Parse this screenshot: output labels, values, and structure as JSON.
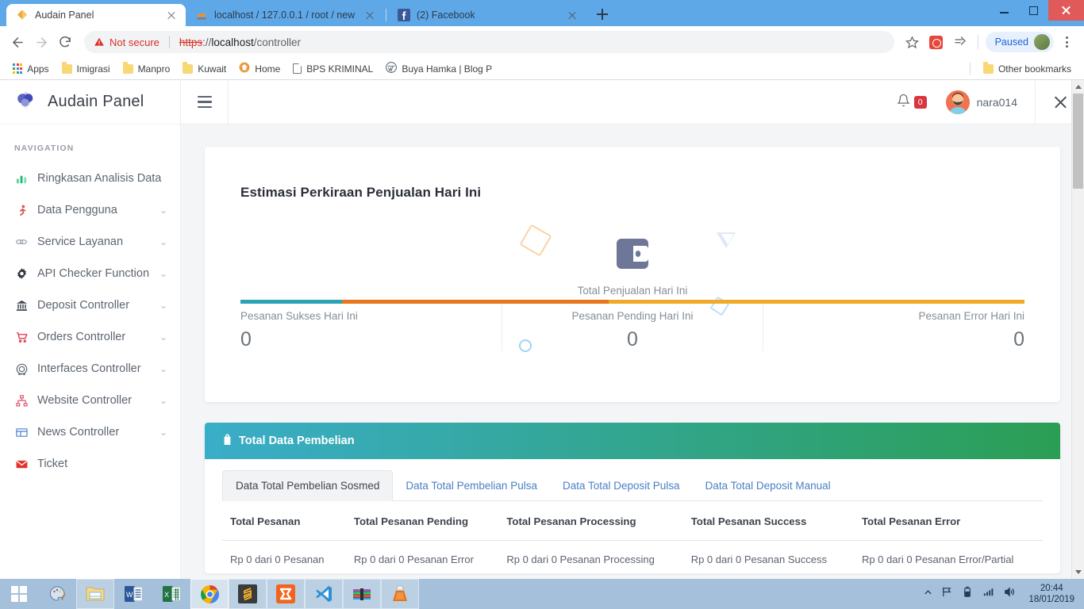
{
  "browser": {
    "tabs": [
      {
        "title": "Audain Panel",
        "favicon": "audain-logo-icon",
        "active": true
      },
      {
        "title": "localhost / 127.0.0.1 / root / new",
        "favicon": "phpmyadmin-icon",
        "active": false
      },
      {
        "title": "(2) Facebook",
        "favicon": "facebook-icon",
        "active": false
      }
    ],
    "new_tab_label": "+",
    "omnibox": {
      "security_label": "Not secure",
      "url_scheme": "https",
      "url_separator": "://",
      "url_host": "localhost",
      "url_path": "/controller"
    },
    "profile_label": "Paused",
    "bookmarks": [
      {
        "label": "Apps",
        "icon": "apps-grid-icon"
      },
      {
        "label": "Imigrasi",
        "icon": "folder-icon"
      },
      {
        "label": "Manpro",
        "icon": "folder-icon"
      },
      {
        "label": "Kuwait",
        "icon": "folder-icon"
      },
      {
        "label": "Home",
        "icon": "home-globe-icon"
      },
      {
        "label": "BPS KRIMINAL",
        "icon": "document-icon"
      },
      {
        "label": "Buya Hamka | Blog P",
        "icon": "wordpress-icon"
      }
    ],
    "other_bookmarks_label": "Other bookmarks"
  },
  "app": {
    "brand": "Audain Panel",
    "nav_heading": "NAVIGATION",
    "sidebar_items": [
      {
        "label": "Ringkasan Analisis Data",
        "icon": "bar-chart-icon",
        "color": "#3ec77a",
        "caret": false
      },
      {
        "label": "Data Pengguna",
        "icon": "user-running-icon",
        "color": "#e0553f",
        "caret": true
      },
      {
        "label": "Service Layanan",
        "icon": "link-icon",
        "color": "#9aa3ab",
        "caret": true
      },
      {
        "label": "API Checker Function",
        "icon": "gear-icon",
        "color": "#2f3640",
        "caret": true
      },
      {
        "label": "Deposit Controller",
        "icon": "bank-icon",
        "color": "#3d4651",
        "caret": true
      },
      {
        "label": "Orders Controller",
        "icon": "shopping-cart-icon",
        "color": "#e0334b",
        "caret": true
      },
      {
        "label": "Interfaces Controller",
        "icon": "badge-circle-icon",
        "color": "#5b6570",
        "caret": true
      },
      {
        "label": "Website Controller",
        "icon": "sitemap-icon",
        "color": "#e05771",
        "caret": true
      },
      {
        "label": "News Controller",
        "icon": "window-layout-icon",
        "color": "#4f7fd1",
        "caret": true
      },
      {
        "label": "Ticket",
        "icon": "envelope-icon",
        "color": "#e0342c",
        "caret": false
      }
    ],
    "topbar": {
      "menu_icon": "hamburger-icon",
      "notification_icon": "bell-icon",
      "notification_count": "0",
      "username": "nara014",
      "close_icon": "close-icon"
    },
    "sales_card": {
      "title": "Estimasi Perkiraan Penjualan Hari Ini",
      "center_icon": "wallet-icon",
      "total_label": "Total Penjualan Hari Ini",
      "kpis": [
        {
          "label": "Pesanan Sukses Hari Ini",
          "value": "0",
          "color": "#2ba3b5"
        },
        {
          "label": "Pesanan Pending Hari Ini",
          "value": "0",
          "color": "#e8761e"
        },
        {
          "label": "Pesanan Error Hari Ini",
          "value": "0",
          "color": "#f0a929"
        }
      ]
    },
    "purchases_card": {
      "header_title": "Total Data Pembelian",
      "header_icon": "shopping-bag-icon",
      "header_gradient_from": "#3aadc9",
      "header_gradient_to": "#2b9e55",
      "tabs": [
        {
          "label": "Data Total Pembelian Sosmed",
          "active": true
        },
        {
          "label": "Data Total Pembelian Pulsa",
          "active": false
        },
        {
          "label": "Data Total Deposit Pulsa",
          "active": false
        },
        {
          "label": "Data Total Deposit Manual",
          "active": false
        }
      ],
      "table": {
        "columns": [
          "Total Pesanan",
          "Total Pesanan Pending",
          "Total Pesanan Processing",
          "Total Pesanan Success",
          "Total Pesanan Error"
        ],
        "rows": [
          [
            "Rp 0 dari 0 Pesanan",
            "Rp 0 dari 0 Pesanan Error",
            "Rp 0 dari 0 Pesanan Processing",
            "Rp 0 dari 0 Pesanan Success",
            "Rp 0 dari 0 Pesanan Error/Partial"
          ]
        ]
      }
    }
  },
  "chart_data": {
    "type": "bar",
    "title": "Estimasi Perkiraan Penjualan Hari Ini",
    "categories": [
      "Pesanan Sukses Hari Ini",
      "Pesanan Pending Hari Ini",
      "Pesanan Error Hari Ini"
    ],
    "values": [
      0,
      0,
      0
    ],
    "segment_widths_pct": [
      13,
      34,
      53
    ],
    "colors": [
      "#2ba3b5",
      "#e8761e",
      "#f0a929"
    ],
    "xlabel": "",
    "ylabel": "Total Penjualan Hari Ini",
    "grid": false,
    "legend": "none"
  },
  "taskbar": {
    "start_icon": "windows-start-icon",
    "items": [
      {
        "icon": "paint-icon",
        "state": "pinned"
      },
      {
        "icon": "file-explorer-icon",
        "state": "open"
      },
      {
        "icon": "word-icon",
        "state": "pinned"
      },
      {
        "icon": "excel-icon",
        "state": "pinned"
      },
      {
        "icon": "chrome-icon",
        "state": "active"
      },
      {
        "icon": "sublime-text-icon",
        "state": "open"
      },
      {
        "icon": "xampp-icon",
        "state": "open"
      },
      {
        "icon": "vscode-icon",
        "state": "open"
      },
      {
        "icon": "winrar-icon",
        "state": "open"
      },
      {
        "icon": "vlc-icon",
        "state": "open"
      }
    ],
    "tray_icons": [
      "show-hidden-icons",
      "flag-icon",
      "battery-icon",
      "network-icon",
      "volume-icon"
    ],
    "clock_time": "20:44",
    "clock_date": "18/01/2019"
  }
}
